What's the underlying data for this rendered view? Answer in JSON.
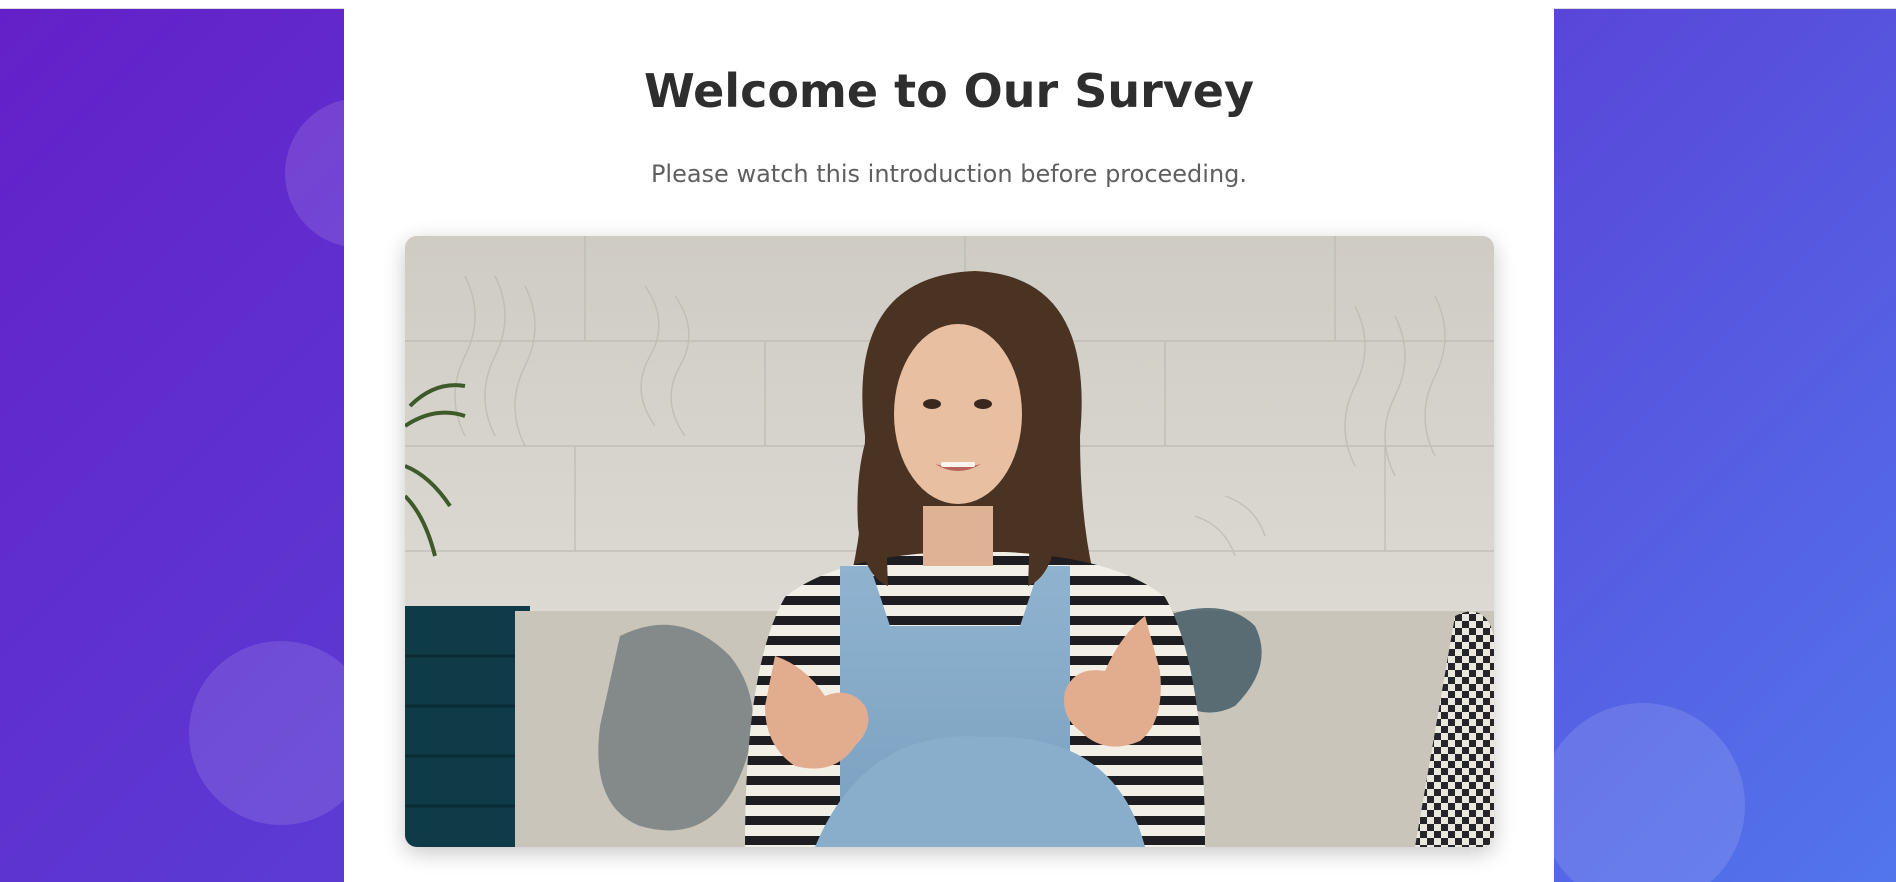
{
  "page": {
    "title": "Welcome to Our Survey",
    "subtitle": "Please watch this introduction before proceeding."
  },
  "video": {
    "description_icon": "video-thumbnail-icon"
  },
  "colors": {
    "background_gradient_start": "#6420c8",
    "background_gradient_end": "#5275ec",
    "card_background": "#ffffff",
    "title_color": "#2e2e2e",
    "subtitle_color": "#5f5f5f"
  }
}
